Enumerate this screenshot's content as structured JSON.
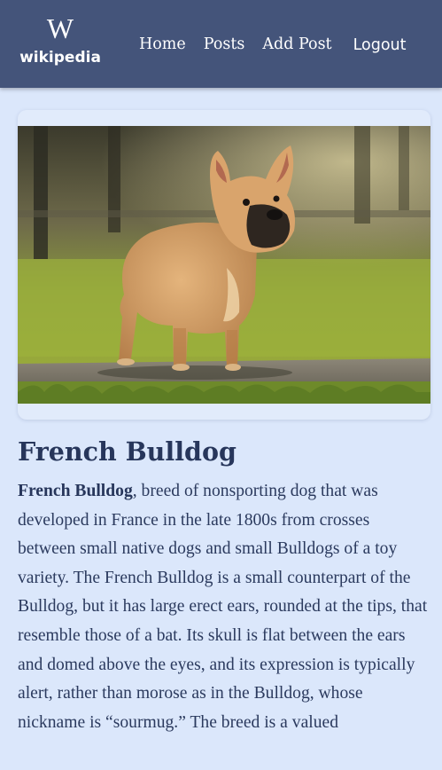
{
  "header": {
    "logo_mark": "W",
    "logo_text": "wikipedia",
    "nav": {
      "home": "Home",
      "posts": "Posts",
      "add_post": "Add Post",
      "logout": "Logout"
    }
  },
  "article": {
    "title": "French Bulldog",
    "lead_term": "French Bulldog",
    "body": ", breed of nonsporting dog that was developed in France in the late 1800s from crosses between small native dogs and small Bulldogs of a toy variety. The French Bulldog is a small counterpart of the Bulldog, but it has large erect ears, rounded at the tips, that resemble those of a bat. Its skull is flat between the ears and domed above the eyes, and its expression is typically alert, rather than morose as in the Bulldog, whose nickname is “sourmug.” The breed is a valued"
  },
  "colors": {
    "header_bg": "#44547a",
    "page_bg": "#dbe7fb",
    "text": "#2b3a5e"
  }
}
